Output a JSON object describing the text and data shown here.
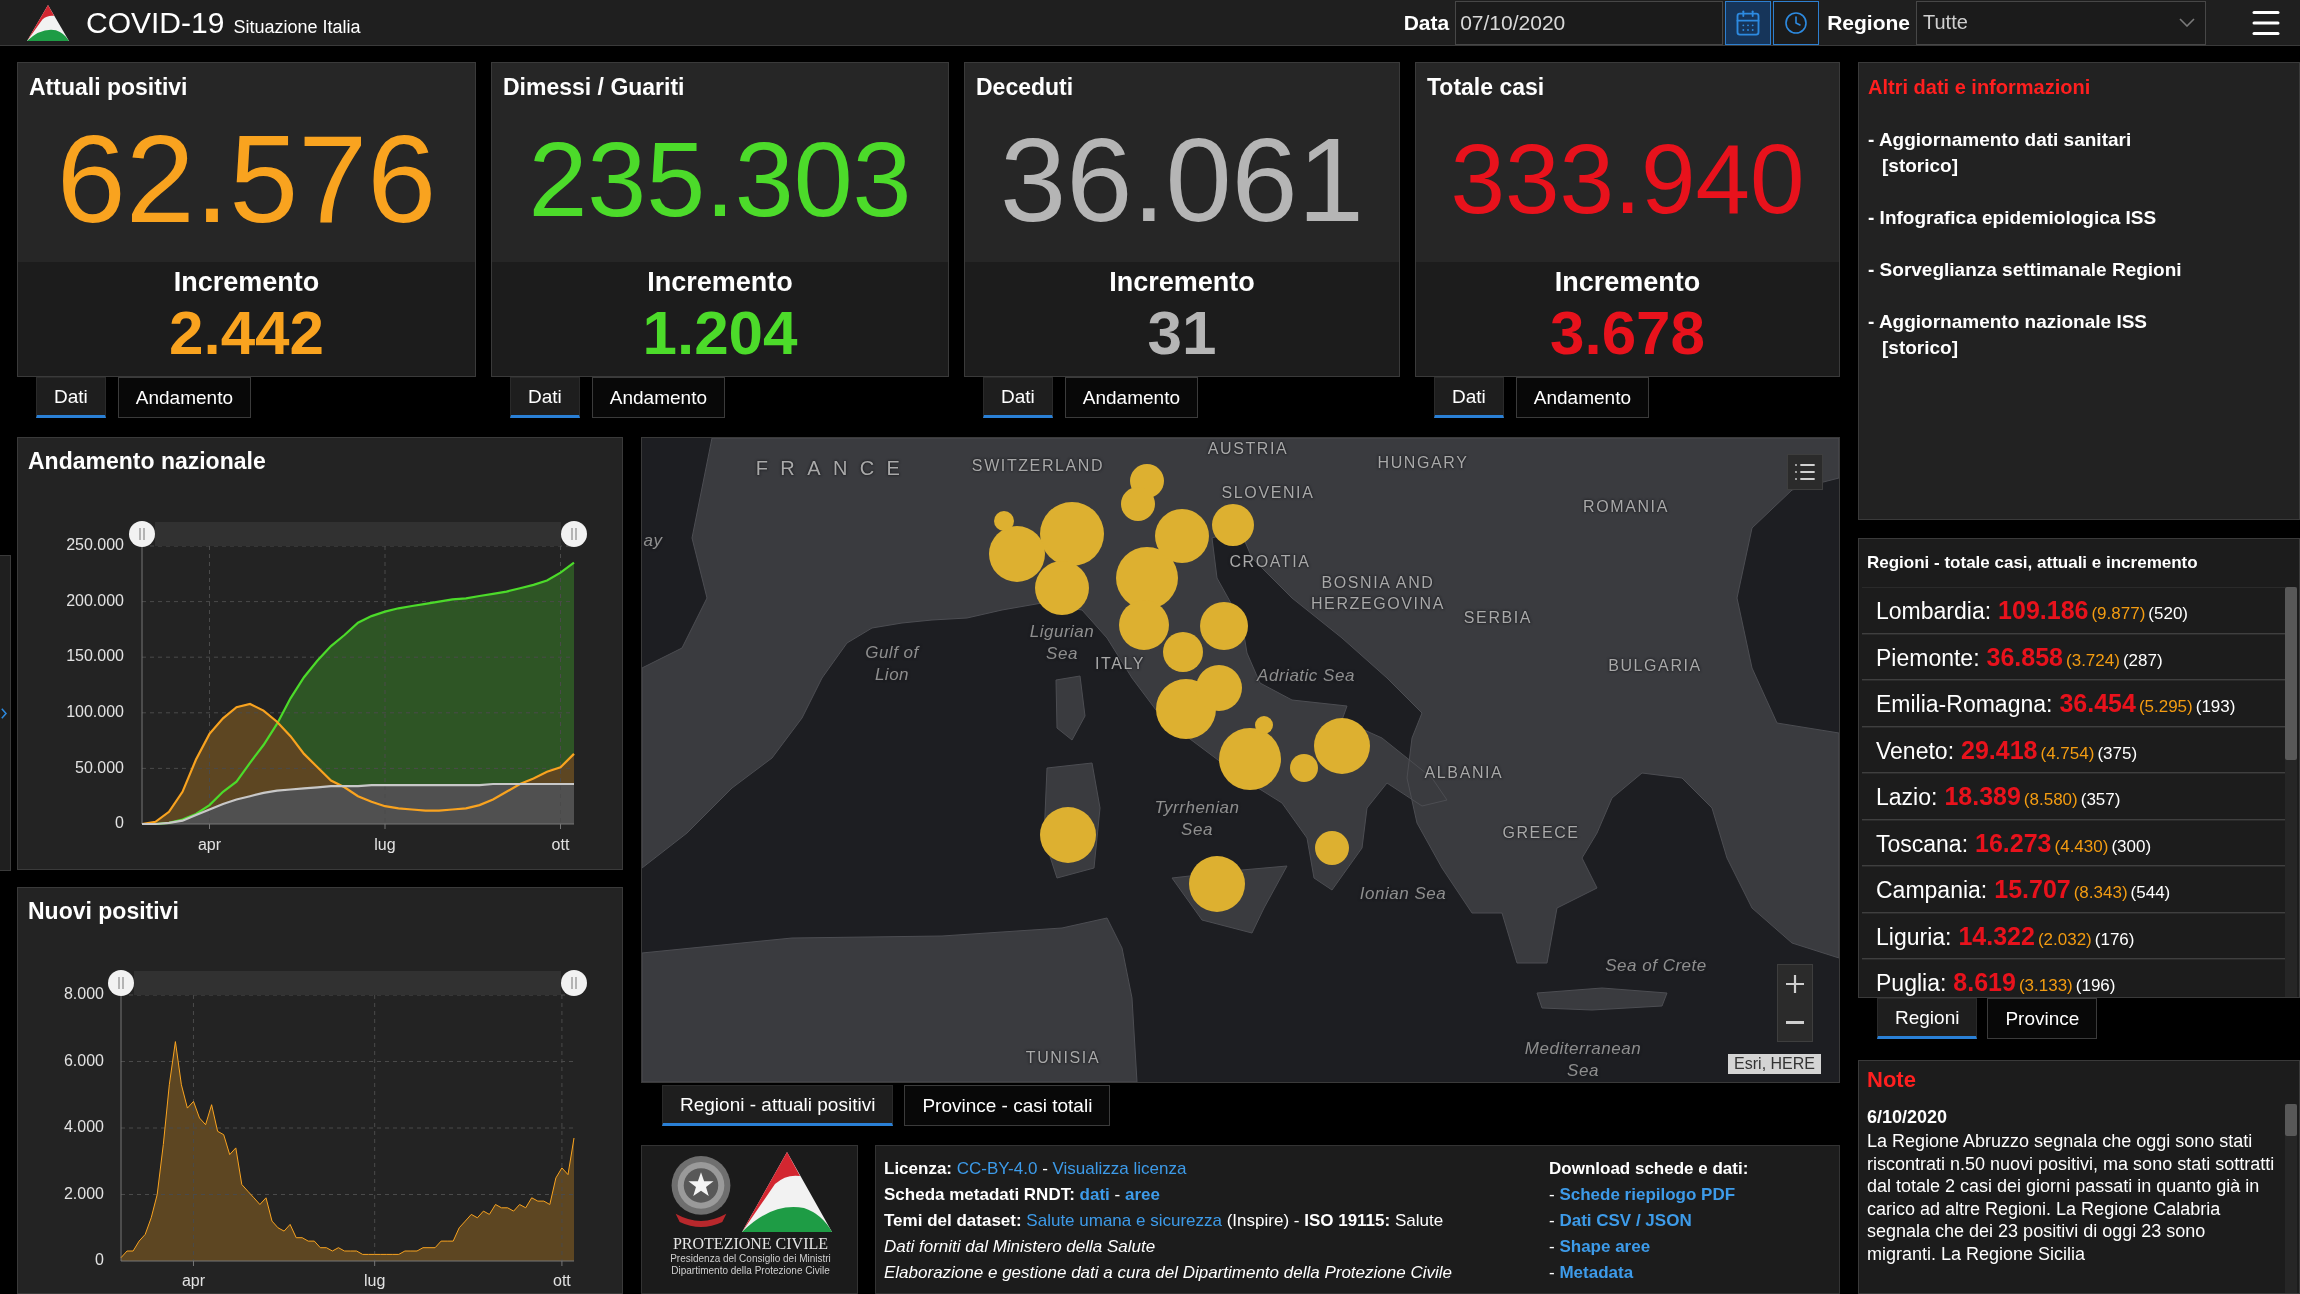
{
  "top_bar": {
    "title": "COVID-19",
    "subtitle": "Situazione Italia",
    "date_label": "Data",
    "date_value": "07/10/2020",
    "region_label": "Regione",
    "region_value": "Tutte"
  },
  "cards": [
    {
      "title": "Attuali positivi",
      "value": "62.576",
      "increment_label": "Incremento",
      "increment": "2.442",
      "color": "#f9a31f",
      "tabs": [
        {
          "label": "Dati",
          "selected": true
        },
        {
          "label": "Andamento",
          "selected": false
        }
      ]
    },
    {
      "title": "Dimessi / Guariti",
      "value": "235.303",
      "increment_label": "Incremento",
      "increment": "1.204",
      "color": "#4cdb2a",
      "tabs": [
        {
          "label": "Dati",
          "selected": true
        },
        {
          "label": "Andamento",
          "selected": false
        }
      ]
    },
    {
      "title": "Deceduti",
      "value": "36.061",
      "increment_label": "Incremento",
      "increment": "31",
      "color": "#b5b5b5",
      "tabs": [
        {
          "label": "Dati",
          "selected": true
        },
        {
          "label": "Andamento",
          "selected": false
        }
      ]
    },
    {
      "title": "Totale casi",
      "value": "333.940",
      "increment_label": "Incremento",
      "increment": "3.678",
      "color": "#e8121c",
      "tabs": [
        {
          "label": "Dati",
          "selected": true
        },
        {
          "label": "Andamento",
          "selected": false
        }
      ]
    }
  ],
  "info_panel": {
    "title": "Altri dati e informazioni",
    "links": [
      {
        "label": "- Aggiornamento dati sanitari",
        "sub": "[storico]"
      },
      {
        "label": "- Infografica epidemiologica ISS"
      },
      {
        "label": "- Sorveglianza settimanale Regioni"
      },
      {
        "label": "- Aggiornamento nazionale ISS",
        "sub": "[storico]"
      }
    ]
  },
  "charts": [
    {
      "title": "Andamento nazionale",
      "range_slider": {
        "level": 1
      },
      "chart_data": {
        "type": "area",
        "grid": true,
        "categories": [
          null,
          null,
          null,
          null,
          null,
          "apr",
          null,
          null,
          null,
          null,
          null,
          null,
          null,
          null,
          null,
          null,
          null,
          null,
          "lug",
          null,
          null,
          null,
          null,
          null,
          null,
          null,
          null,
          null,
          null,
          null,
          null,
          "ott",
          null
        ],
        "ylim": [
          0,
          250
        ],
        "yticks": [
          {
            "value": 0,
            "label": "0"
          },
          {
            "value": 50,
            "label": "50.000"
          },
          {
            "value": 100,
            "label": "100.000"
          },
          {
            "value": 150,
            "label": "150.000"
          },
          {
            "value": 200,
            "label": "200.000"
          },
          {
            "value": 250,
            "label": "250.000"
          }
        ],
        "series": [
          {
            "color": "#4cdb2a",
            "values": [
              0,
              0,
              1,
              4,
              9,
              17,
              29,
              38,
              55,
              71,
              90,
              113,
              132,
              147,
              160,
              170,
              181,
              187,
              191,
              194,
              196,
              198,
              200,
              202,
              203,
              205,
              207,
              209,
              212,
              215,
              219,
              226,
              235
            ]
          },
          {
            "color": "#f9a31f",
            "values": [
              0,
              2,
              11,
              29,
              58,
              81,
              95,
              105,
              108,
              102,
              92,
              79,
              63,
              51,
              39,
              33,
              25,
              20,
              16,
              14,
              13,
              12,
              12,
              13,
              14,
              17,
              22,
              29,
              36,
              41,
              47,
              51,
              63
            ]
          },
          {
            "color": "#c8c8c8",
            "values": [
              0,
              0,
              1,
              3,
              8,
              13,
              18,
              22,
              25,
              28,
              30,
              31,
              32,
              33,
              34,
              34,
              34,
              35,
              35,
              35,
              35,
              35,
              35,
              35,
              35,
              35,
              36,
              36,
              36,
              36,
              36,
              36,
              36
            ]
          }
        ]
      }
    },
    {
      "title": "Nuovi positivi",
      "range_slider": {
        "level": 1
      },
      "chart_data": {
        "type": "area",
        "grid": true,
        "categories": [
          null,
          null,
          null,
          null,
          null,
          null,
          null,
          null,
          null,
          null,
          null,
          null,
          "apr",
          null,
          null,
          null,
          null,
          null,
          null,
          null,
          null,
          null,
          null,
          null,
          null,
          null,
          null,
          null,
          null,
          null,
          null,
          null,
          null,
          null,
          null,
          null,
          null,
          null,
          null,
          null,
          null,
          null,
          "lug",
          null,
          null,
          null,
          null,
          null,
          null,
          null,
          null,
          null,
          null,
          null,
          null,
          null,
          null,
          null,
          null,
          null,
          null,
          null,
          null,
          null,
          null,
          null,
          null,
          null,
          null,
          null,
          null,
          null,
          null,
          "ott",
          null,
          null
        ],
        "ylim": [
          0,
          8
        ],
        "yticks": [
          {
            "value": 0,
            "label": "0"
          },
          {
            "value": 2,
            "label": "2.000"
          },
          {
            "value": 4,
            "label": "4.000"
          },
          {
            "value": 6,
            "label": "6.000"
          },
          {
            "value": 8,
            "label": "8.000"
          }
        ],
        "series": [
          {
            "color": "#f9a31f",
            "values": [
              0.1,
              0.3,
              0.3,
              0.6,
              0.8,
              1.3,
              2.0,
              3.5,
              5.3,
              6.6,
              5.3,
              4.6,
              4.8,
              4.3,
              4.1,
              4.7,
              3.9,
              3.8,
              3.2,
              3.4,
              2.3,
              2.1,
              1.9,
              1.7,
              1.9,
              1.2,
              1.0,
              0.9,
              1.1,
              0.7,
              0.7,
              0.6,
              0.6,
              0.4,
              0.4,
              0.3,
              0.4,
              0.3,
              0.3,
              0.3,
              0.2,
              0.2,
              0.2,
              0.2,
              0.2,
              0.2,
              0.2,
              0.3,
              0.3,
              0.3,
              0.4,
              0.4,
              0.4,
              0.6,
              0.6,
              0.6,
              1.0,
              1.2,
              1.4,
              1.3,
              1.5,
              1.4,
              1.7,
              1.6,
              1.6,
              1.5,
              1.7,
              1.6,
              1.9,
              1.8,
              1.8,
              1.7,
              2.5,
              2.8,
              2.6,
              3.7
            ]
          }
        ]
      }
    }
  ],
  "map": {
    "labels": [
      {
        "text": "FRANCE",
        "kind": "country"
      },
      {
        "text": "SWITZERLAND",
        "kind": "country"
      },
      {
        "text": "AUSTRIA",
        "kind": "country"
      },
      {
        "text": "HUNGARY",
        "kind": "country"
      },
      {
        "text": "SLOVENIA",
        "kind": "country"
      },
      {
        "text": "ROMANIA",
        "kind": "country"
      },
      {
        "text": "ay",
        "kind": "sea"
      },
      {
        "text": "CROATIA",
        "kind": "country"
      },
      {
        "text": "BOSNIA AND HERZEGOVINA",
        "kind": "country"
      },
      {
        "text": "SERBIA",
        "kind": "country"
      },
      {
        "text": "Gulf of Lion",
        "kind": "sea"
      },
      {
        "text": "Ligurian Sea",
        "kind": "sea"
      },
      {
        "text": "ITALY",
        "kind": "country"
      },
      {
        "text": "Adriatic Sea",
        "kind": "sea"
      },
      {
        "text": "BULGARIA",
        "kind": "country"
      },
      {
        "text": "ALBANIA",
        "kind": "country"
      },
      {
        "text": "Tyrrhenian Sea",
        "kind": "sea"
      },
      {
        "text": "GREECE",
        "kind": "country"
      },
      {
        "text": "Ionian Sea",
        "kind": "sea"
      },
      {
        "text": "Sea of Crete",
        "kind": "sea"
      },
      {
        "text": "TUNISIA",
        "kind": "country"
      },
      {
        "text": "Mediterranean Sea",
        "kind": "sea"
      }
    ],
    "attribution": "Esri, HERE",
    "tabs": [
      {
        "label": "Regioni - attuali positivi",
        "selected": true
      },
      {
        "label": "Province - casi totali",
        "selected": false
      }
    ]
  },
  "footer": {
    "logo": {
      "wordmark": "PROTEZIONE CIVILE",
      "captions": [
        "Presidenza del Consiglio dei Ministri",
        "Dipartimento della Protezione Civile"
      ]
    },
    "info_lines": [
      [
        {
          "kind": "label",
          "text": "Licenza:"
        },
        {
          "kind": "link",
          "text": "CC-BY-4.0"
        },
        {
          "kind": "text",
          "text": "-"
        },
        {
          "kind": "link",
          "text": "Visualizza licenza"
        }
      ],
      [
        {
          "kind": "label",
          "text": "Scheda metadati RNDT:"
        },
        {
          "kind": "strong_link",
          "text": "dati"
        },
        {
          "kind": "text",
          "text": "-"
        },
        {
          "kind": "strong_link",
          "text": "aree"
        }
      ],
      [
        {
          "kind": "label",
          "text": "Temi del dataset:"
        },
        {
          "kind": "link",
          "text": "Salute umana e sicurezza"
        },
        {
          "kind": "text",
          "text": "(Inspire) -"
        },
        {
          "kind": "label",
          "text": "ISO 19115:"
        },
        {
          "kind": "text",
          "text": "Salute"
        }
      ],
      [
        {
          "kind": "note",
          "text": "Dati forniti dal Ministero della Salute"
        }
      ],
      [
        {
          "kind": "note",
          "text": "Elaborazione e gestione dati a cura del Dipartimento della Protezione Civile"
        }
      ]
    ],
    "downloads": {
      "title": "Download schede e dati:",
      "items": [
        {
          "bullet": "-",
          "link": "Schede riepilogo PDF"
        },
        {
          "bullet": "-",
          "link": "Dati CSV / JSON"
        },
        {
          "bullet": "-",
          "link": "Shape aree"
        },
        {
          "bullet": "-",
          "link": "Metadata"
        }
      ]
    }
  },
  "regions_panel": {
    "title": "Regioni - totale casi, attuali e incremento",
    "rows": [
      {
        "name": "Lombardia:",
        "total": "109.186",
        "active": "(9.877)",
        "increment": "(520)"
      },
      {
        "name": "Piemonte:",
        "total": "36.858",
        "active": "(3.724)",
        "increment": "(287)"
      },
      {
        "name": "Emilia-Romagna:",
        "total": "36.454",
        "active": "(5.295)",
        "increment": "(193)"
      },
      {
        "name": "Veneto:",
        "total": "29.418",
        "active": "(4.754)",
        "increment": "(375)"
      },
      {
        "name": "Lazio:",
        "total": "18.389",
        "active": "(8.580)",
        "increment": "(357)"
      },
      {
        "name": "Toscana:",
        "total": "16.273",
        "active": "(4.430)",
        "increment": "(300)"
      },
      {
        "name": "Campania:",
        "total": "15.707",
        "active": "(8.343)",
        "increment": "(544)"
      },
      {
        "name": "Liguria:",
        "total": "14.322",
        "active": "(2.032)",
        "increment": "(176)"
      },
      {
        "name": "Puglia:",
        "total": "8.619",
        "active": "(3.133)",
        "increment": "(196)"
      }
    ],
    "tabs": [
      {
        "label": "Regioni",
        "selected": true
      },
      {
        "label": "Province",
        "selected": false
      }
    ]
  },
  "note": {
    "title": "Note",
    "date": "6/10/2020",
    "text": "La Regione Abruzzo segnala che oggi sono stati riscontrati n.50 nuovi positivi, ma sono stati sottratti dal totale 2 casi dei giorni passati in quanto già in carico ad altre Regioni. La Regione Calabria segnala che dei 23 positivi di oggi 23 sono migranti. La Regione Sicilia"
  }
}
